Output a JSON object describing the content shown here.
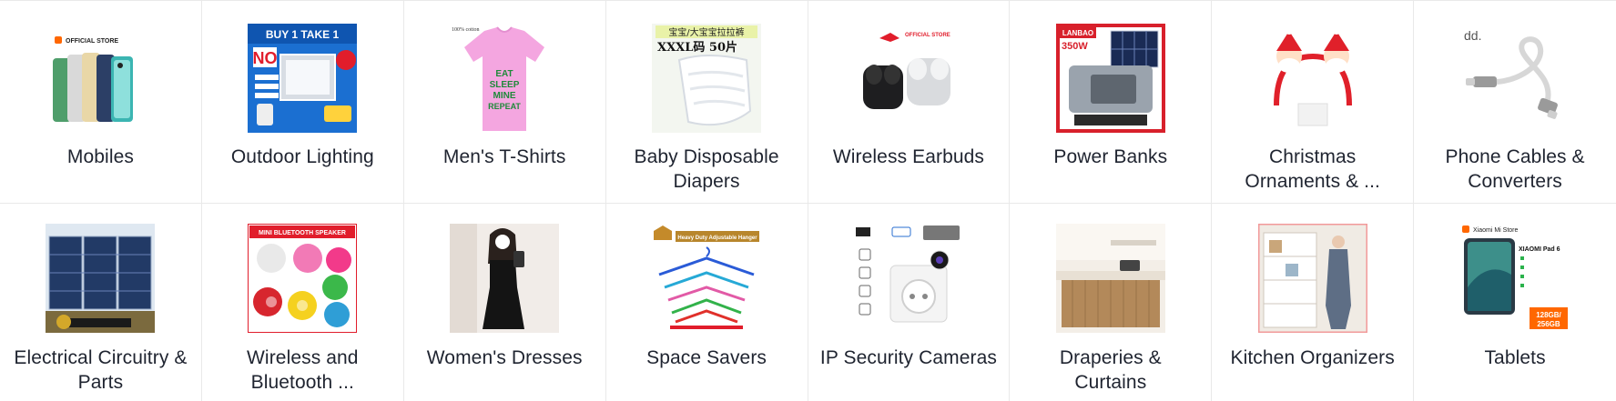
{
  "categories": [
    {
      "label": "Mobiles",
      "icon": "smartphones-icon",
      "overlay": "OFFICIAL STORE"
    },
    {
      "label": "Outdoor Lighting",
      "icon": "solar-floodlight-icon",
      "overlay": "BUY 1 TAKE 1"
    },
    {
      "label": "Men's T-Shirts",
      "icon": "pink-tshirt-icon",
      "overlay": "EAT SLEEP MINE REPEAT"
    },
    {
      "label": "Baby Disposable Diapers",
      "icon": "diaper-pack-icon",
      "overlay": "XXXL码 50片"
    },
    {
      "label": "Wireless Earbuds",
      "icon": "earbuds-icon",
      "overlay": "OFFICIAL STORE"
    },
    {
      "label": "Power Banks",
      "icon": "solar-power-station-icon",
      "overlay": "350W"
    },
    {
      "label": "Christmas Ornaments & ...",
      "icon": "santa-headband-icon",
      "overlay": ""
    },
    {
      "label": "Phone Cables & Converters",
      "icon": "usb-c-cable-icon",
      "overlay": "dd."
    },
    {
      "label": "Electrical Circuitry & Parts",
      "icon": "solar-panels-icon",
      "overlay": ""
    },
    {
      "label": "Wireless and Bluetooth ...",
      "icon": "bluetooth-speakers-icon",
      "overlay": "MINI BLUETOOTH SPEAKER"
    },
    {
      "label": "Women's Dresses",
      "icon": "black-dress-icon",
      "overlay": ""
    },
    {
      "label": "Space Savers",
      "icon": "adjustable-hanger-icon",
      "overlay": "Heavy Duty Adjustable Hanger"
    },
    {
      "label": "IP Security Cameras",
      "icon": "socket-camera-icon",
      "overlay": ""
    },
    {
      "label": "Draperies & Curtains",
      "icon": "kitchen-curtain-icon",
      "overlay": ""
    },
    {
      "label": "Kitchen Organizers",
      "icon": "kitchen-cabinet-icon",
      "overlay": ""
    },
    {
      "label": "Tablets",
      "icon": "tablet-icon",
      "overlay": "Xiaomi Mi Store"
    }
  ],
  "colors": {
    "text": "#1f2430",
    "divider": "#e9e9e9",
    "accent_red": "#e11d2b",
    "accent_orange": "#ff6700"
  }
}
